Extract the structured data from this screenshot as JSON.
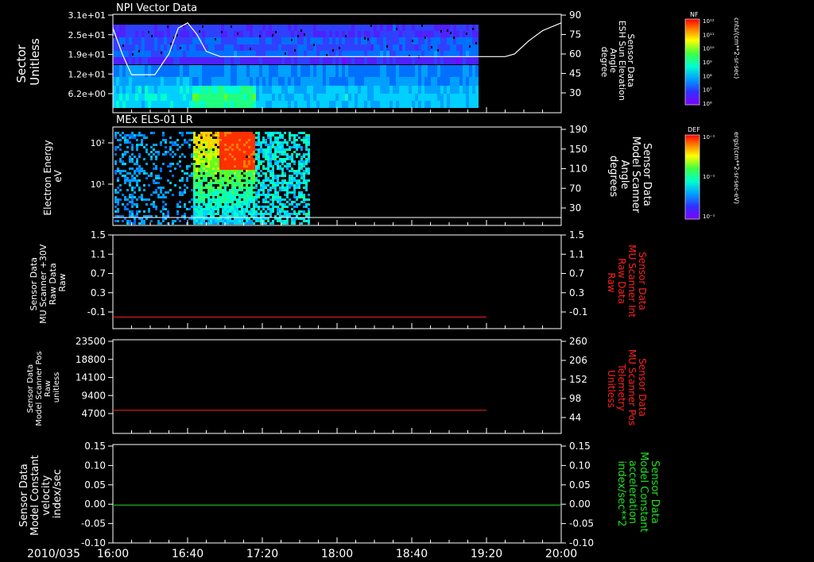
{
  "colors": {
    "background": "#000000",
    "axis": "#ffffff",
    "red_line": "#ff2020",
    "green_line": "#20e020"
  },
  "date_label": "2010/035",
  "x_axis": {
    "ticks": [
      "16:00",
      "16:40",
      "17:20",
      "18:00",
      "18:40",
      "19:20",
      "20:00"
    ]
  },
  "chart_data": [
    {
      "type": "heatmap",
      "title": "NPI Vector Data",
      "ylabel_lines": [
        "Sector",
        "Unitless"
      ],
      "y_ticks": [
        "3.1e+01",
        "2.5e+01",
        "1.9e+01",
        "1.2e+01",
        "6.2e+00"
      ],
      "right_ylabel_lines": [
        "Sensor Data",
        "ESH Sun Elevation",
        "Angle",
        "degree"
      ],
      "right_ticks": [
        "90",
        "75",
        "60",
        "45",
        "30"
      ],
      "colorbar": {
        "label": "NF",
        "units": "cnts/(cm**2-sr-sec)",
        "ticks": [
          "10¹²",
          "10¹¹",
          "10¹⁰",
          "10⁹",
          "10⁸",
          "10⁷",
          "10⁶"
        ]
      },
      "data_extent_x": [
        "16:00",
        "19:15"
      ],
      "overlay_line": {
        "name": "Sun Elevation Angle",
        "units": "degree",
        "points": [
          [
            0,
            80
          ],
          [
            10,
            60
          ],
          [
            20,
            44
          ],
          [
            30,
            44
          ],
          [
            45,
            44
          ],
          [
            60,
            60
          ],
          [
            70,
            80
          ],
          [
            80,
            84
          ],
          [
            90,
            75
          ],
          [
            100,
            62
          ],
          [
            115,
            58
          ],
          [
            200,
            58
          ],
          [
            300,
            58
          ],
          [
            390,
            58
          ],
          [
            420,
            58
          ],
          [
            430,
            60
          ],
          [
            445,
            70
          ],
          [
            460,
            78
          ],
          [
            480,
            84
          ]
        ]
      }
    },
    {
      "type": "heatmap",
      "title": "MEx ELS-01 LR",
      "ylabel_lines": [
        "Electron Energy",
        "eV"
      ],
      "y_ticks": [
        "10²",
        "10¹"
      ],
      "right_ylabel_lines": [
        "Sensor Data",
        "Model Scanner",
        "Angle",
        "degrees"
      ],
      "right_ticks": [
        "190",
        "150",
        "110",
        "70",
        "30"
      ],
      "colorbar": {
        "label": "DEF",
        "units": "ergs/(cm**2-sr-sec-eV)",
        "ticks": [
          "10⁻¹",
          "10⁻¹",
          "10⁻¹"
        ]
      },
      "data_extent_x": [
        "16:00",
        "17:45"
      ],
      "overlay_line": {
        "name": "Model Scanner Angle",
        "units": "degrees",
        "constant": 10
      }
    },
    {
      "type": "line",
      "ylabel_lines": [
        "Sensor Data",
        "MU Scanner +30V",
        "Raw Data",
        "Raw"
      ],
      "y_ticks": [
        "1.5",
        "1.1",
        "0.7",
        "0.3",
        "-0.1"
      ],
      "ylim": [
        -0.3,
        1.5
      ],
      "right_ylabel_lines": [
        "Sensor Data",
        "MU Scanner Int",
        "Raw Data",
        "Raw"
      ],
      "right_ticks": [
        "1.5",
        "1.1",
        "0.7",
        "0.3",
        "-0.1"
      ],
      "series": [
        {
          "x": [
            "16:00",
            "19:20"
          ],
          "values": [
            0.0,
            0.0
          ]
        }
      ]
    },
    {
      "type": "line",
      "ylabel_lines": [
        "Sensor Data",
        "Model Scanner Pos",
        "Raw",
        "unitless"
      ],
      "y_ticks": [
        "23500",
        "18800",
        "14100",
        "9400",
        "4700"
      ],
      "ylim": [
        0,
        23500
      ],
      "right_ylabel_lines": [
        "Sensor Data",
        "MU Scanner Pos",
        "Telemetry",
        "Unitless"
      ],
      "right_ticks": [
        "260",
        "206",
        "152",
        "98",
        "44"
      ],
      "series": [
        {
          "x": [
            "16:00",
            "19:20"
          ],
          "values": [
            8000,
            8000
          ]
        }
      ]
    },
    {
      "type": "line",
      "ylabel_lines": [
        "Sensor Data",
        "Model Constant",
        "velocity",
        "index/sec"
      ],
      "y_ticks": [
        "0.15",
        "0.10",
        "0.05",
        "0.00",
        "-0.05",
        "-0.10"
      ],
      "ylim": [
        -0.1,
        0.15
      ],
      "right_ylabel_lines": [
        "Sensor Data",
        "Model Constant",
        "acceleration",
        "index/sec**2"
      ],
      "right_ticks": [
        "0.15",
        "0.10",
        "0.05",
        "0.00",
        "-0.05",
        "-0.10"
      ],
      "series": [
        {
          "x": [
            "16:00",
            "20:00"
          ],
          "values": [
            0.0,
            0.0
          ]
        }
      ]
    }
  ]
}
